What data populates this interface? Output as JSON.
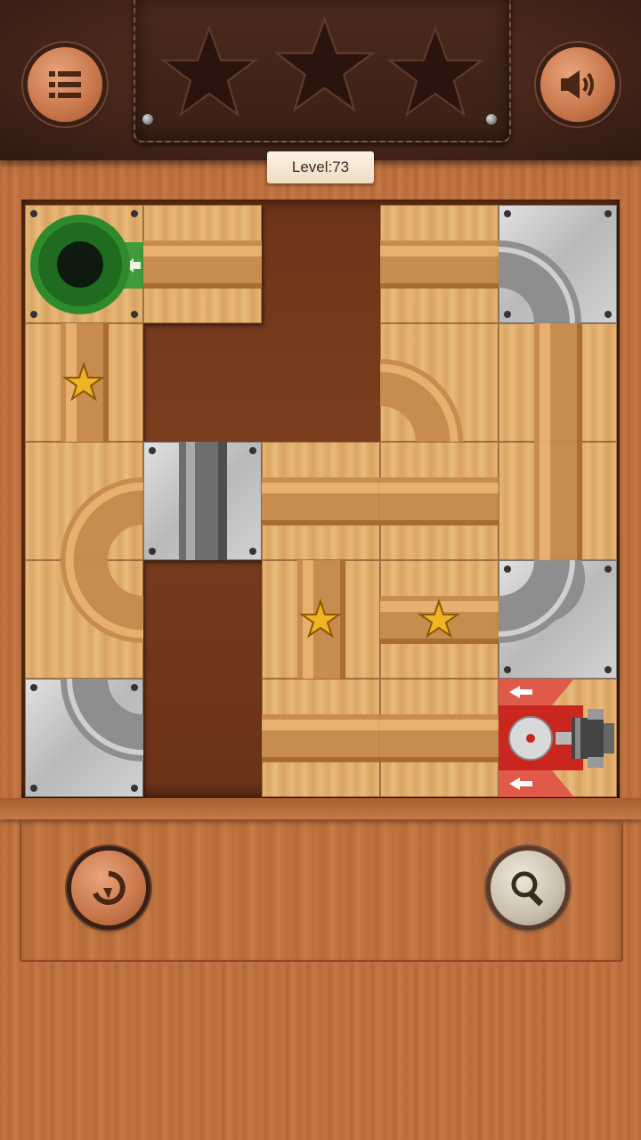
{
  "header": {
    "menu_icon": "list-menu-icon",
    "sound_icon": "speaker-icon",
    "stars": [
      {
        "slot": 1,
        "earned": false
      },
      {
        "slot": 2,
        "earned": false
      },
      {
        "slot": 3,
        "earned": false
      }
    ]
  },
  "level": {
    "label": "Level:73"
  },
  "board": {
    "columns": 5,
    "rows": 5,
    "tiles": [
      [
        "start-goal",
        "wood-horizontal",
        "empty",
        "wood-horizontal",
        "metal-elbow-left-down"
      ],
      [
        "wood-vertical-star",
        "empty",
        "empty",
        "wood-elbow-left-down",
        "wood-vertical"
      ],
      [
        "wood-elbow-right-down",
        "metal-vertical",
        "wood-horizontal",
        "wood-horizontal",
        "wood-vertical"
      ],
      [
        "wood-elbow-up-right",
        "empty",
        "wood-vertical-star",
        "wood-horizontal-star",
        "metal-elbow-up-left"
      ],
      [
        "metal-elbow-right-down",
        "empty",
        "wood-horizontal",
        "wood-horizontal",
        "ball-launcher"
      ]
    ]
  },
  "controls": {
    "restart_icon": "restart-icon",
    "hint_icon": "magnifier-icon"
  }
}
